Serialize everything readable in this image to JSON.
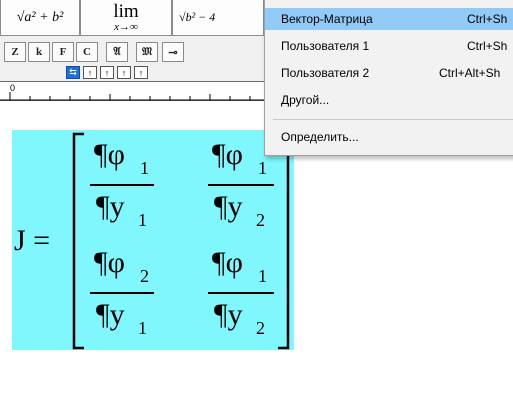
{
  "toolbar": {
    "templates": {
      "sqrt_sum": "√a² + b²",
      "lim": "lim",
      "lim_sub": "x→∞",
      "sqrt_diff": "√b² − 4"
    },
    "symbols": [
      "Z",
      "k",
      "F",
      "C",
      "𝔄",
      "𝔐",
      "⊸"
    ],
    "tab_tools": [
      "⇆",
      "↑",
      "↑",
      "↑",
      "↑"
    ]
  },
  "ruler": {
    "label": "0"
  },
  "menu": {
    "items": [
      {
        "label": "Вектор-Матрица",
        "shortcut": "Ctrl+Sh",
        "highlighted": true
      },
      {
        "label": "Пользователя 1",
        "shortcut": "Ctrl+Sh"
      },
      {
        "label": "Пользователя 2",
        "shortcut": "Ctrl+Alt+Sh"
      },
      {
        "label": "Другой..."
      },
      {
        "label": "Определить..."
      }
    ]
  },
  "equation": {
    "lhs": "J =",
    "cells": [
      {
        "num": "¶φ",
        "num_sub": "1",
        "den": "¶y",
        "den_sub": "1"
      },
      {
        "num": "¶φ",
        "num_sub": "1",
        "den": "¶y",
        "den_sub": "2"
      },
      {
        "num": "¶φ",
        "num_sub": "2",
        "den": "¶y",
        "den_sub": "1"
      },
      {
        "num": "¶φ",
        "num_sub": "1",
        "den": "¶y",
        "den_sub": "2"
      }
    ]
  },
  "colors": {
    "selection": "#80f6fd",
    "menu_highlight": "#91c9f7",
    "active_tool": "#1e6fd9"
  }
}
